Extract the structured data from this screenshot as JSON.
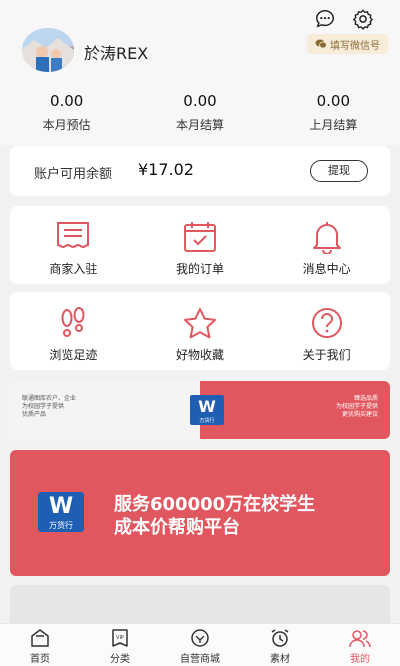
{
  "user": {
    "name": "於涛REX"
  },
  "header": {
    "wechat_button": "填写微信号"
  },
  "stats": [
    {
      "value": "0.00",
      "label": "本月预估"
    },
    {
      "value": "0.00",
      "label": "本月结算"
    },
    {
      "value": "0.00",
      "label": "上月结算"
    }
  ],
  "balance": {
    "label": "账户可用余额",
    "amount": "¥17.02",
    "withdraw_label": "提现"
  },
  "menu_row1": [
    {
      "label": "商家入驻",
      "icon": "merchant-icon"
    },
    {
      "label": "我的订单",
      "icon": "orders-icon"
    },
    {
      "label": "消息中心",
      "icon": "bell-icon"
    }
  ],
  "menu_row2": [
    {
      "label": "浏览足迹",
      "icon": "footprint-icon"
    },
    {
      "label": "好物收藏",
      "icon": "star-icon"
    },
    {
      "label": "关于我们",
      "icon": "question-icon"
    }
  ],
  "banner_small": {
    "left_lines": [
      "联通图库农户、企业",
      "为校园学子提供",
      "优质产品"
    ],
    "right_lines": [
      "臻选品质",
      "为校园学子提供",
      "更优购买建议"
    ],
    "logo_letter": "W",
    "logo_name": "万货行"
  },
  "banner_large": {
    "logo_letter": "W",
    "logo_name": "万货行",
    "line1": "服务600000万在校学生",
    "line2": "成本价帮购平台"
  },
  "tabs": [
    {
      "label": "首页",
      "icon": "home-icon",
      "active": false
    },
    {
      "label": "分类",
      "icon": "vip-icon",
      "active": false
    },
    {
      "label": "自营商城",
      "icon": "mall-icon",
      "active": false
    },
    {
      "label": "素材",
      "icon": "clock-icon",
      "active": false
    },
    {
      "label": "我的",
      "icon": "user-icon",
      "active": true
    }
  ],
  "colors": {
    "accent": "#e0575f",
    "brand_blue": "#1f5fb3",
    "wechat_badge_bg": "#f6ecd9"
  }
}
